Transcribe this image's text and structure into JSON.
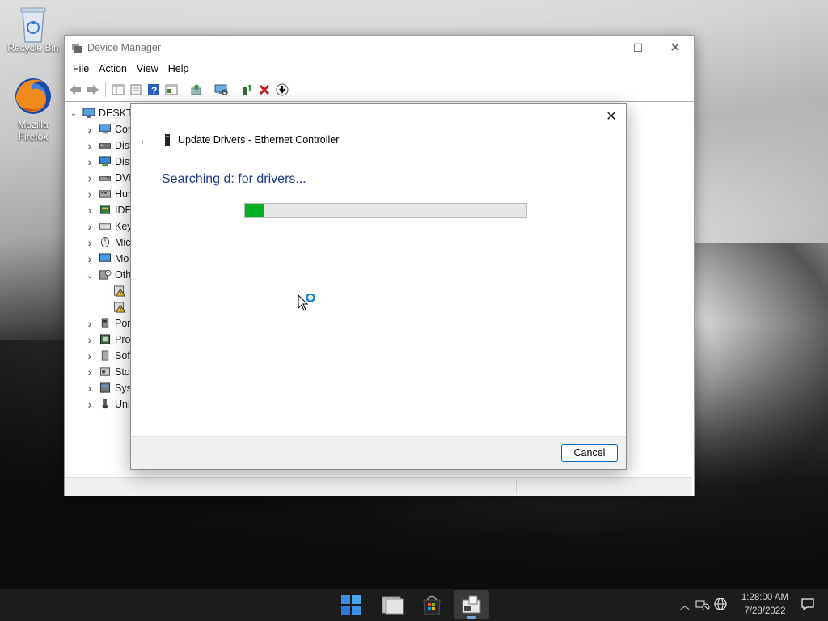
{
  "desktop": {
    "icons": [
      {
        "label": "Recycle Bin"
      },
      {
        "label": "Mozilla\nFirefox"
      }
    ]
  },
  "device_manager": {
    "title": "Device Manager",
    "menu": [
      "File",
      "Action",
      "View",
      "Help"
    ],
    "toolbar_icons": [
      "back-icon",
      "forward-icon",
      "show-hide-tree-icon",
      "properties-icon",
      "help-icon",
      "view-icon",
      "update-driver-icon",
      "scan-hardware-icon",
      "add-driver-icon",
      "uninstall-icon",
      "disable-icon"
    ],
    "tree": {
      "root": "DESKTOP",
      "items": [
        {
          "label": "Com",
          "icon": "computer-icon",
          "expanded": false
        },
        {
          "label": "Disk",
          "icon": "disk-drive-icon",
          "expanded": false
        },
        {
          "label": "Disp",
          "icon": "display-adapter-icon",
          "expanded": false
        },
        {
          "label": "DVD",
          "icon": "dvd-icon",
          "expanded": false
        },
        {
          "label": "Hum",
          "icon": "hid-icon",
          "expanded": false
        },
        {
          "label": "IDE",
          "icon": "ide-icon",
          "expanded": false
        },
        {
          "label": "Key",
          "icon": "keyboard-icon",
          "expanded": false
        },
        {
          "label": "Mic",
          "icon": "mouse-icon",
          "expanded": false
        },
        {
          "label": "Mo",
          "icon": "monitor-icon",
          "expanded": false
        },
        {
          "label": "Oth",
          "icon": "other-devices-icon",
          "expanded": true
        },
        {
          "label": "",
          "icon": "warning-device-icon",
          "child": true
        },
        {
          "label": "",
          "icon": "warning-device-icon",
          "child": true
        },
        {
          "label": "Por",
          "icon": "port-icon",
          "expanded": false
        },
        {
          "label": "Pro",
          "icon": "processor-icon",
          "expanded": false
        },
        {
          "label": "Sof",
          "icon": "software-device-icon",
          "expanded": false
        },
        {
          "label": "Sto",
          "icon": "storage-icon",
          "expanded": false
        },
        {
          "label": "Sys",
          "icon": "system-device-icon",
          "expanded": false
        },
        {
          "label": "Uni",
          "icon": "usb-icon",
          "expanded": false
        }
      ]
    }
  },
  "dialog": {
    "title": "Update Drivers - Ethernet Controller",
    "status": "Searching d: for drivers...",
    "progress_percent": 7,
    "cancel_label": "Cancel"
  },
  "taskbar": {
    "apps": [
      "start-icon",
      "file-explorer-icon",
      "store-icon",
      "device-manager-icon"
    ],
    "time": "1:28:00 AM",
    "date": "7/28/2022"
  }
}
